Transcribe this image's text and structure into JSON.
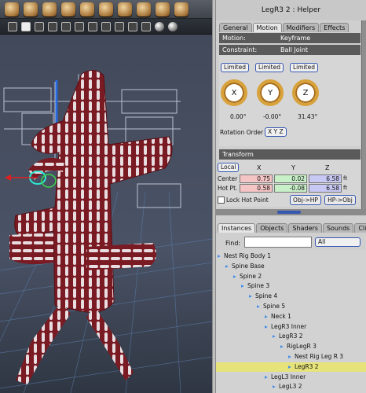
{
  "panel": {
    "title": "LegR3 2 : Helper",
    "tabs": [
      "General",
      "Motion",
      "Modifiers",
      "Effects"
    ],
    "motion": {
      "label": "Motion:",
      "value": "Keyframe"
    },
    "constraint": {
      "label": "Constraint:",
      "value": "Ball Joint"
    },
    "limited": [
      "Limited",
      "Limited",
      "Limited"
    ],
    "dials": [
      {
        "axis": "X",
        "value": "0.00°"
      },
      {
        "axis": "Y",
        "value": "-0.00°"
      },
      {
        "axis": "Z",
        "value": "31.43°"
      }
    ],
    "rotation_order": {
      "label": "Rotation Order",
      "value": "X Y Z"
    },
    "transform": {
      "title": "Transform",
      "space": "Local",
      "cols": [
        "X",
        "Y",
        "Z"
      ],
      "center": {
        "label": "Center",
        "x": "0.75",
        "y": "0.02",
        "z": "6.58",
        "unit": "ft"
      },
      "hotpt": {
        "label": "Hot Pt.",
        "x": "0.58",
        "y": "-0.08",
        "z": "6.58",
        "unit": "ft"
      },
      "lock_label": "Lock Hot Point",
      "obj_hp": "Obj->HP",
      "hp_obj": "HP->Obj"
    }
  },
  "browser": {
    "tabs": [
      "Instances",
      "Objects",
      "Shaders",
      "Sounds",
      "Clips"
    ],
    "find_label": "Find:",
    "filter": "All",
    "tree": [
      {
        "label": "Nest Rig Body 1",
        "indent": 0
      },
      {
        "label": "Spine Base",
        "indent": 1
      },
      {
        "label": "Spine 2",
        "indent": 2
      },
      {
        "label": "Spine 3",
        "indent": 3
      },
      {
        "label": "Spine 4",
        "indent": 4
      },
      {
        "label": "Spine 5",
        "indent": 5
      },
      {
        "label": "Neck 1",
        "indent": 6
      },
      {
        "label": "LegR3 Inner",
        "indent": 6
      },
      {
        "label": "LegR3 2",
        "indent": 7
      },
      {
        "label": "RigLegR 3",
        "indent": 8
      },
      {
        "label": "Nest Rig Leg R 3",
        "indent": 9
      },
      {
        "label": "LegR3 2",
        "indent": 9,
        "selected": true
      },
      {
        "label": "LegL3 Inner",
        "indent": 6
      },
      {
        "label": "LegL3 2",
        "indent": 7
      }
    ]
  }
}
